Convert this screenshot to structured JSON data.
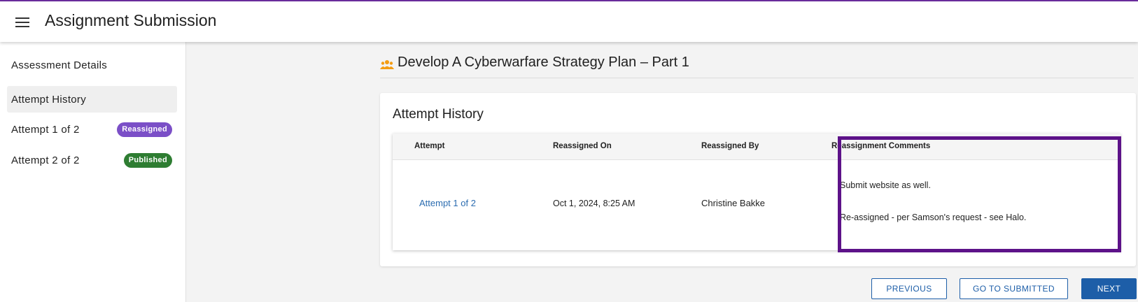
{
  "header": {
    "title": "Assignment Submission",
    "menu_icon": "hamburger-menu-icon"
  },
  "sidebar": {
    "items": [
      {
        "label": "Assessment Details"
      },
      {
        "label": "Attempt History"
      },
      {
        "label": "Attempt 1 of 2",
        "badge": "Reassigned",
        "badge_color": "#7b4fc7"
      },
      {
        "label": "Attempt 2 of 2",
        "badge": "Published",
        "badge_color": "#2e7d32"
      }
    ]
  },
  "page": {
    "title": "Develop A Cyberwarfare Strategy Plan – Part 1",
    "icon": "group-icon"
  },
  "history": {
    "title": "Attempt History",
    "columns": [
      "Attempt",
      "Reassigned On",
      "Reassigned By",
      "Reassignment Comments"
    ],
    "rows": [
      {
        "attempt": "Attempt 1 of 2",
        "reassigned_on": "Oct 1, 2024, 8:25 AM",
        "reassigned_by": "Christine Bakke",
        "comments": [
          "Submit website as well.",
          "Re-assigned - per Samson's request - see Halo."
        ]
      }
    ]
  },
  "actions": {
    "previous": "PREVIOUS",
    "go_to_submitted": "GO TO SUBMITTED",
    "next": "NEXT"
  },
  "colors": {
    "accent": "#1d5ea8",
    "top_border": "#6a2c9e",
    "highlight": "#5d1289",
    "icon": "#f39c12"
  }
}
